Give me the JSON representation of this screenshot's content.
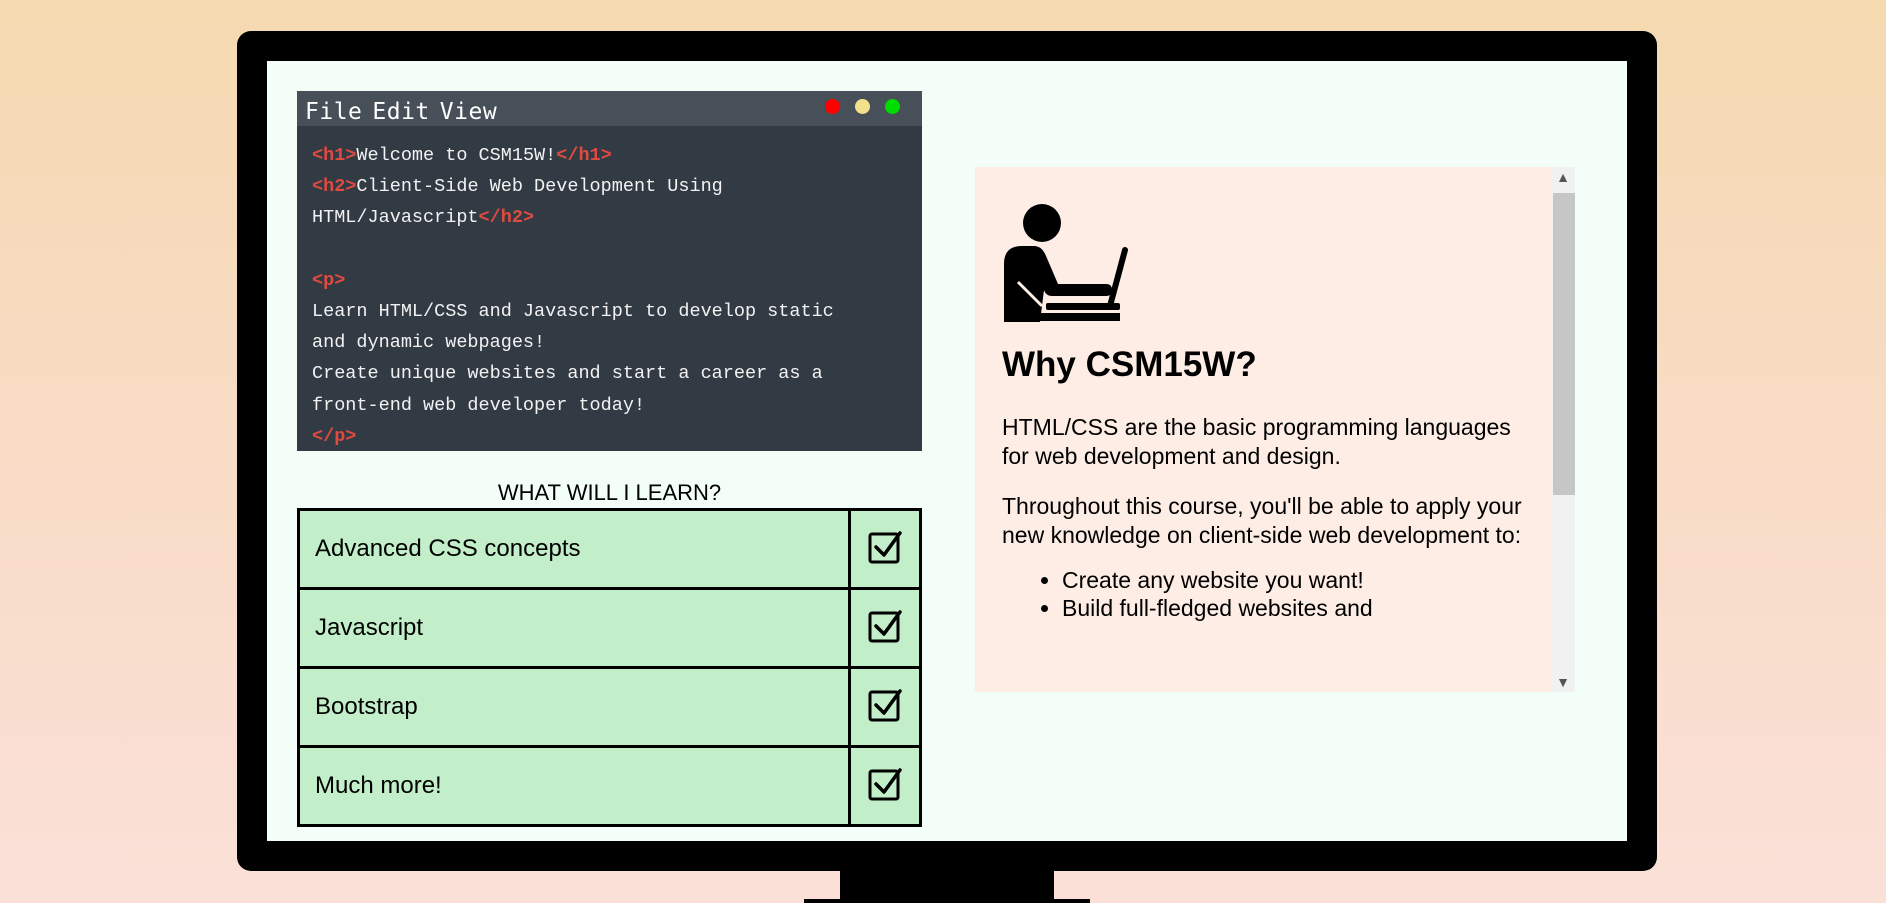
{
  "editor": {
    "menu": [
      "File",
      "Edit",
      "View"
    ],
    "window_controls": {
      "close_color": "#ff0000",
      "minimize_color": "#f2e18a",
      "maximize_color": "#00dd00"
    },
    "lines": [
      [
        {
          "t": "<h1>",
          "c": "tag"
        },
        {
          "t": "Welcome to CSM15W!"
        },
        {
          "t": "</h1>",
          "c": "tag"
        }
      ],
      [
        {
          "t": "<h2>",
          "c": "tag"
        },
        {
          "t": "Client-Side Web Development Using"
        }
      ],
      [
        {
          "t": "HTML/Javascript"
        },
        {
          "t": "</h2>",
          "c": "tag"
        }
      ],
      [],
      [
        {
          "t": "<p>",
          "c": "tag"
        }
      ],
      [
        {
          "t": "Learn HTML/CSS and Javascript to develop static"
        }
      ],
      [
        {
          "t": "and dynamic webpages!"
        }
      ],
      [
        {
          "t": "Create unique websites and start a career as a"
        }
      ],
      [
        {
          "t": "front-end web developer today!"
        }
      ],
      [
        {
          "t": "</p>",
          "c": "tag"
        }
      ]
    ]
  },
  "learn": {
    "title": "WHAT WILL I LEARN?",
    "items": [
      {
        "label": "Advanced CSS concepts",
        "checked": true
      },
      {
        "label": "Javascript",
        "checked": true
      },
      {
        "label": "Bootstrap",
        "checked": true
      },
      {
        "label": "Much more!",
        "checked": true
      }
    ]
  },
  "panel": {
    "icon": "person-laptop-icon",
    "heading": "Why CSM15W?",
    "paragraph1": "HTML/CSS are the basic programming languages for web development and design.",
    "paragraph2": "Throughout this course, you'll be able to apply your new knowledge on client-side web development to:",
    "bullets": [
      "Create any website you want!",
      "Build full-fledged websites and"
    ]
  },
  "colors": {
    "tag": "#e04a40",
    "table_bg": "#c2efc9",
    "panel_bg": "#fdede4",
    "screen_bg": "#f2fef7"
  }
}
